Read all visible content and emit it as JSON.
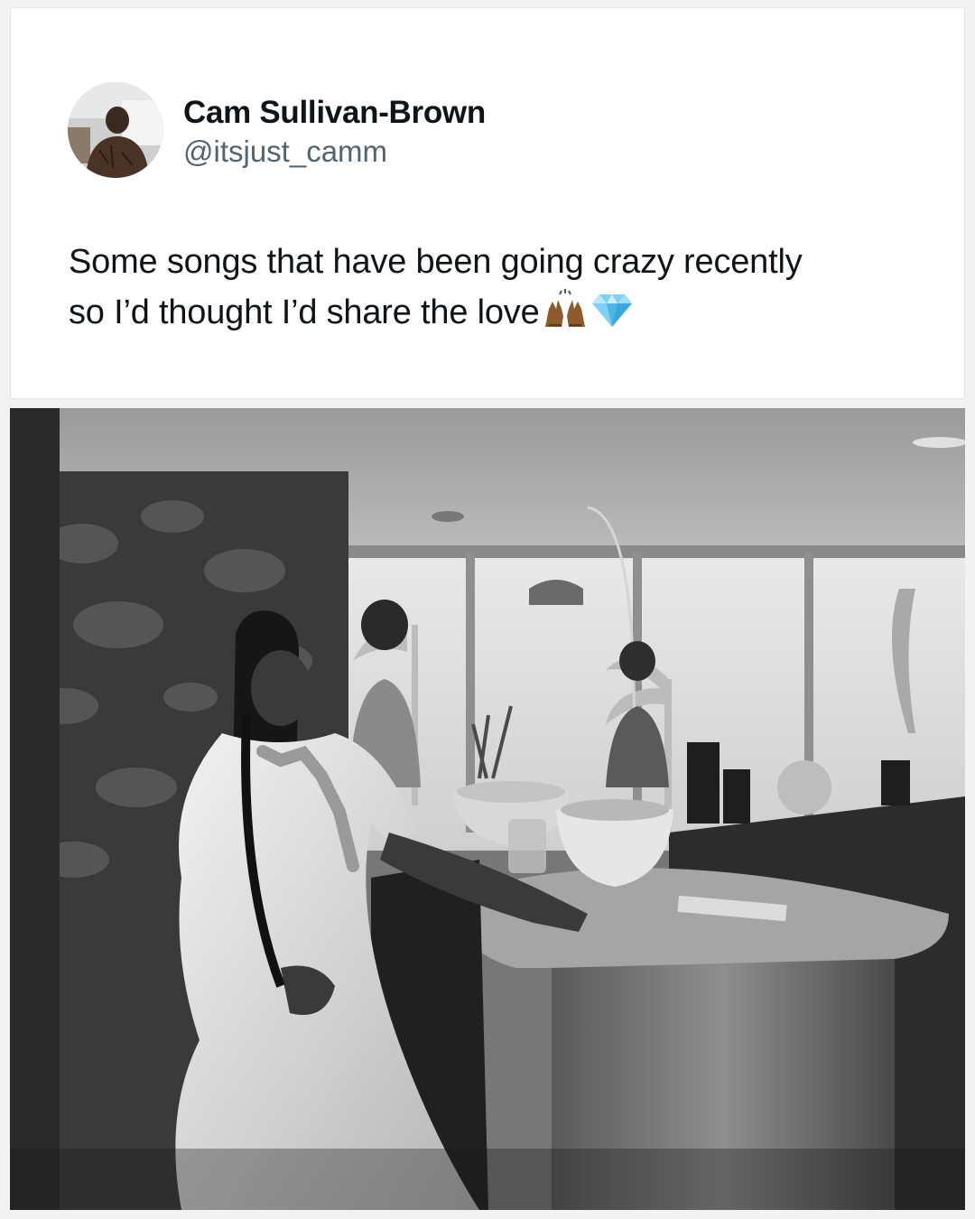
{
  "tweet": {
    "author": {
      "display_name": "Cam Sullivan-Brown",
      "handle": "@itsjust_camm"
    },
    "text_line_1": "Some songs that have been going crazy recently",
    "text_line_2": "so I’d thought I’d share the love",
    "emojis": [
      "raising-hands-emoji",
      "gem-stone-emoji"
    ]
  },
  "media": {
    "type": "image",
    "style": "black-and-white photo",
    "colors": {
      "tone_dark": "#2a2a2a",
      "tone_light": "#dcdcdc"
    }
  }
}
